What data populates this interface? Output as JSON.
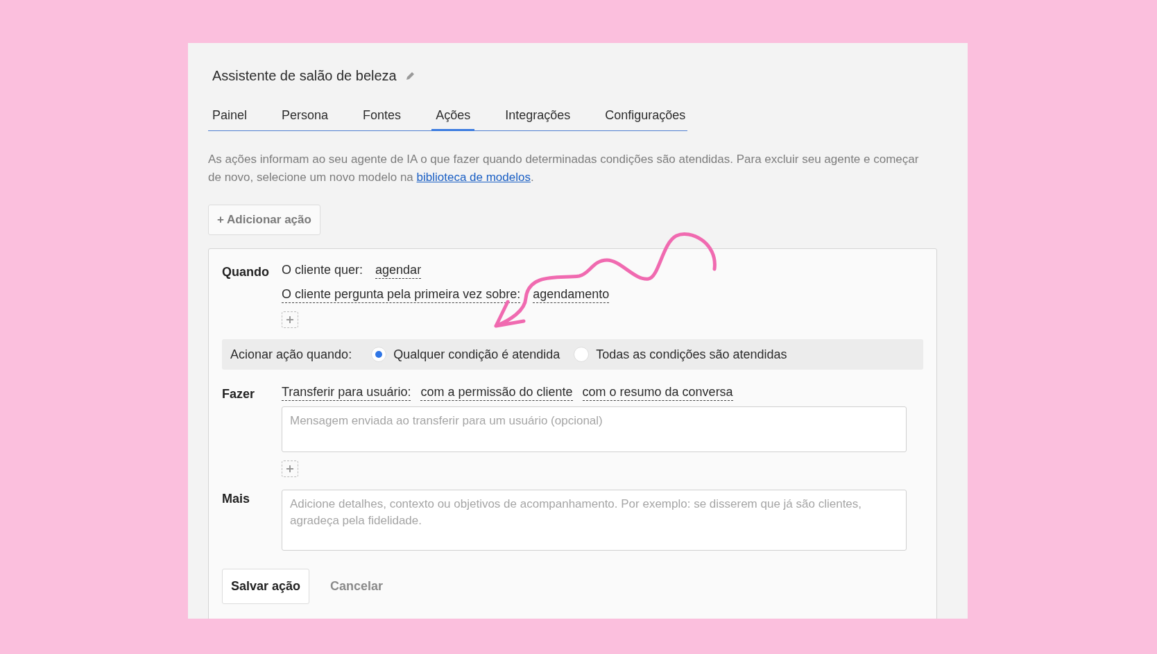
{
  "title": "Assistente de salão de beleza",
  "tabs": [
    {
      "label": "Painel",
      "selected": false
    },
    {
      "label": "Persona",
      "selected": false
    },
    {
      "label": "Fontes",
      "selected": false
    },
    {
      "label": "Ações",
      "selected": true
    },
    {
      "label": "Integrações",
      "selected": false
    },
    {
      "label": "Configurações",
      "selected": false
    }
  ],
  "description": {
    "text": "As ações informam ao seu agente de IA o que fazer quando determinadas condições são atendidas.  Para excluir seu agente e começar de novo, selecione um novo modelo na ",
    "link": "biblioteca de modelos",
    "after": "."
  },
  "add_button": "+ Adicionar ação",
  "when": {
    "label": "Quando",
    "conditions": [
      {
        "label": "O cliente quer:",
        "underlined": false,
        "value": "agendar"
      },
      {
        "label": "O cliente pergunta pela primeira vez sobre:",
        "underlined": true,
        "value": "agendamento"
      }
    ]
  },
  "trigger": {
    "label": "Acionar ação quando:",
    "options": [
      {
        "label": "Qualquer condição é atendida",
        "selected": true
      },
      {
        "label": "Todas as condições são atendidas",
        "selected": false
      }
    ]
  },
  "do": {
    "label": "Fazer",
    "action": "Transferir para usuário:",
    "options": [
      "com a permissão do cliente",
      "com o resumo da conversa"
    ],
    "placeholder": "Mensagem enviada ao transferir para um usuário (opcional)"
  },
  "more": {
    "label": "Mais",
    "placeholder": "Adicione detalhes, contexto ou objetivos de acompanhamento. Por exemplo: se disserem que já são clientes, agradeça pela fidelidade."
  },
  "buttons": [
    {
      "label": "Salvar ação",
      "kind": "primary"
    },
    {
      "label": "Cancelar",
      "kind": "link"
    }
  ]
}
